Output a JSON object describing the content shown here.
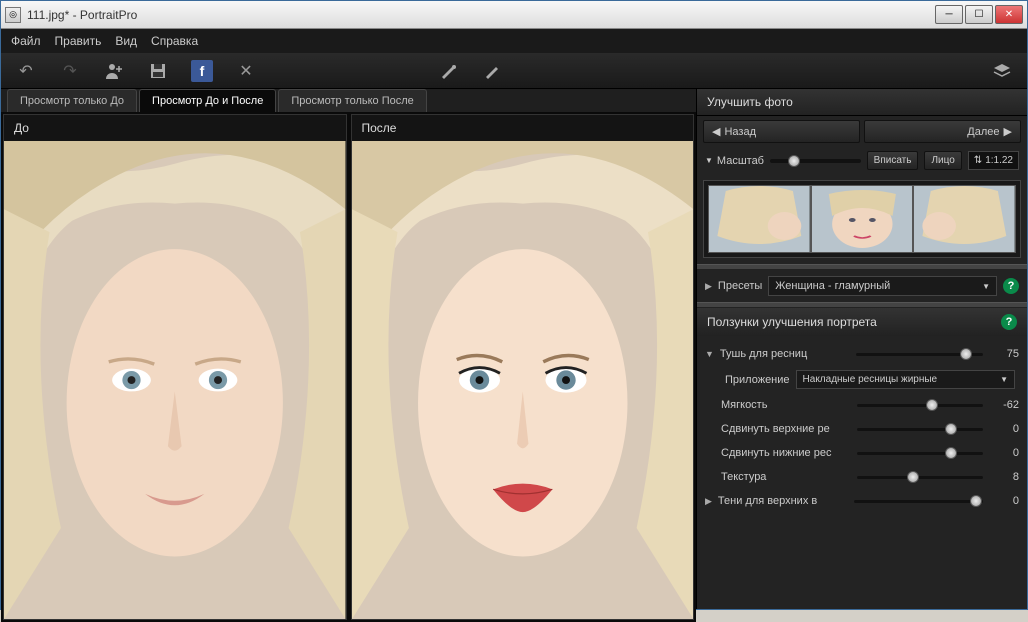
{
  "window": {
    "title": "111.jpg* - PortraitPro"
  },
  "menu": {
    "file": "Файл",
    "edit": "Править",
    "view": "Вид",
    "help": "Справка"
  },
  "tabs": {
    "before_only": "Просмотр только До",
    "before_after": "Просмотр До и После",
    "after_only": "Просмотр только После"
  },
  "pane": {
    "before": "До",
    "after": "После"
  },
  "side": {
    "enhance_title": "Улучшить фото",
    "back": "Назад",
    "next": "Далее",
    "zoom_label": "Масштаб",
    "fit": "Вписать",
    "face": "Лицо",
    "ratio": "1:1.22",
    "presets_label": "Пресеты",
    "preset_value": "Женщина - гламурный",
    "sliders_title": "Ползунки улучшения портрета"
  },
  "sliders": {
    "mascara": {
      "label": "Тушь для ресниц",
      "value": "75",
      "pos": 82
    },
    "app_label": "Приложение",
    "app_value": "Накладные ресницы жирные",
    "softness": {
      "label": "Мягкость",
      "value": "-62",
      "pos": 55
    },
    "shift_upper": {
      "label": "Сдвинуть верхние ре",
      "value": "0",
      "pos": 70
    },
    "shift_lower": {
      "label": "Сдвинуть нижние рес",
      "value": "0",
      "pos": 70
    },
    "texture": {
      "label": "Текстура",
      "value": "8",
      "pos": 40
    },
    "upper_shadow": {
      "label": "Тени для верхних в",
      "value": "0",
      "pos": 90
    }
  }
}
